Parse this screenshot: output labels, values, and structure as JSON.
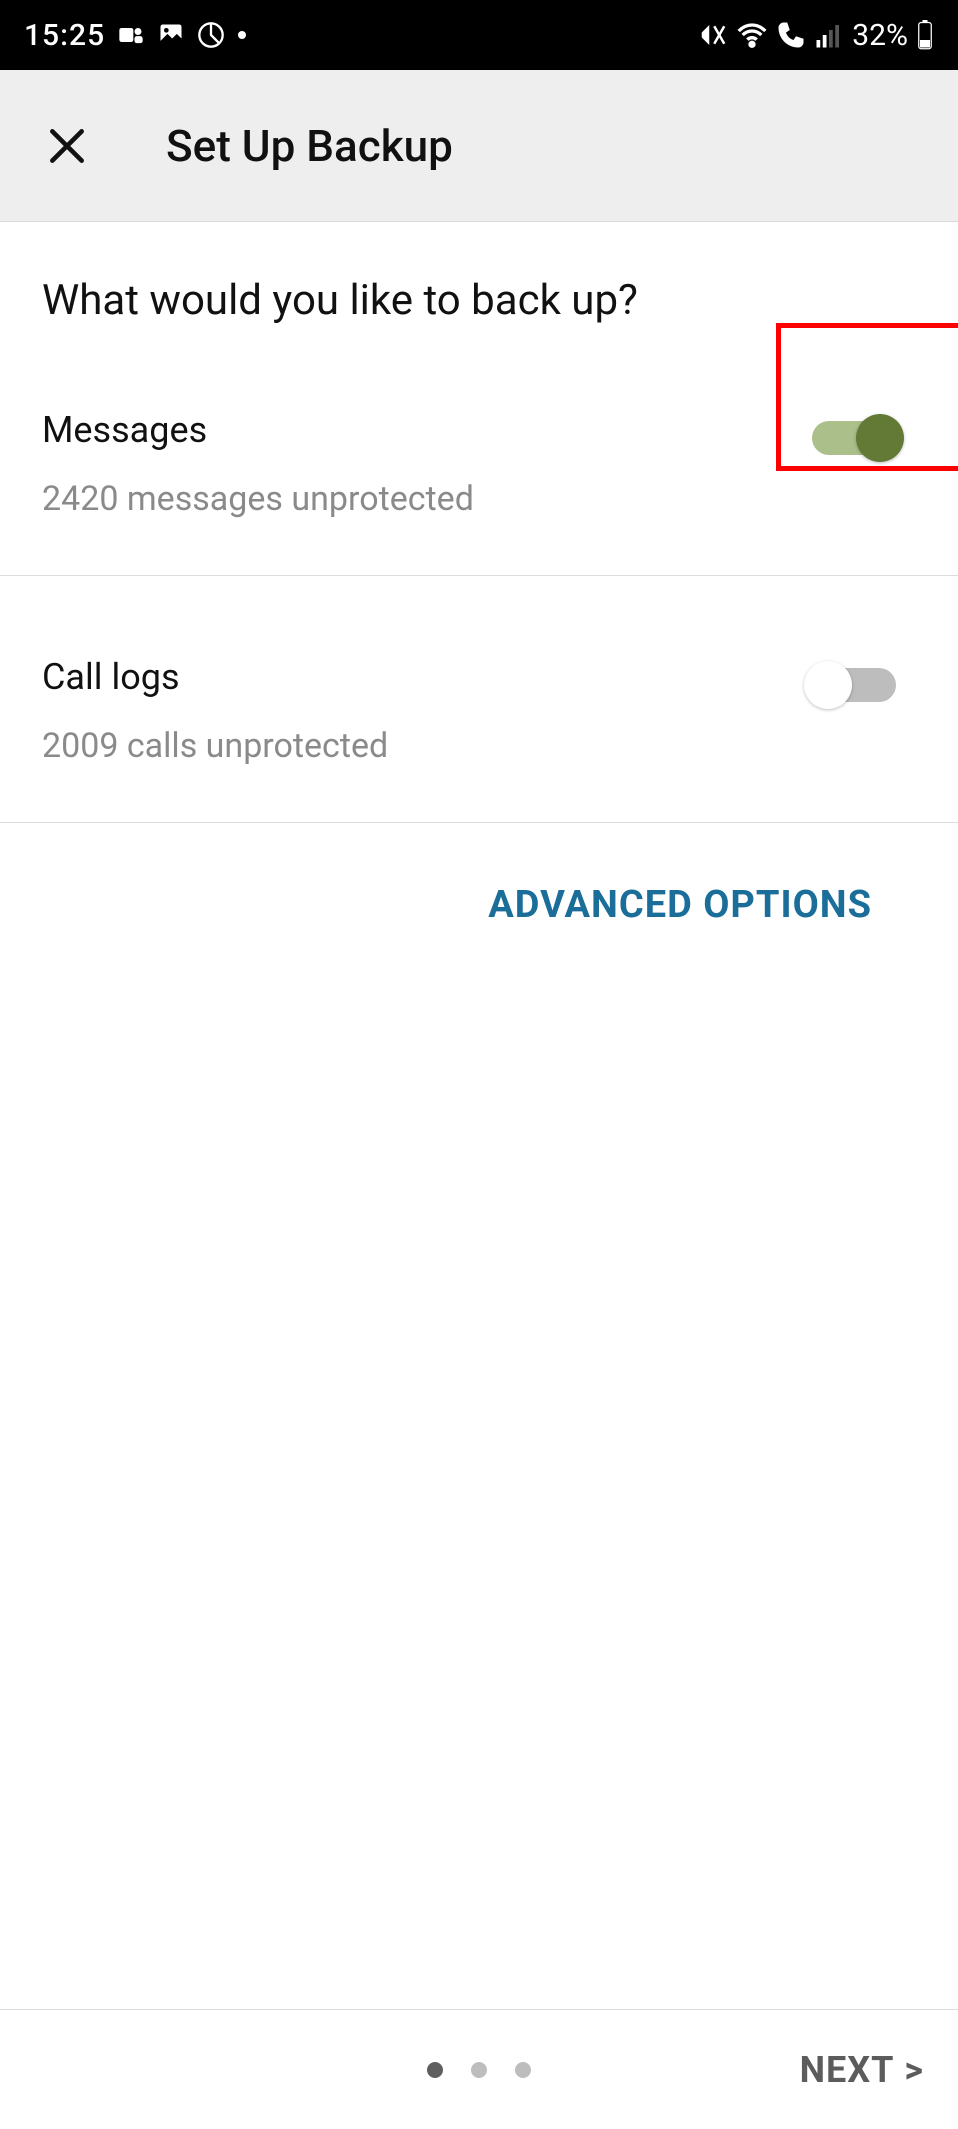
{
  "status": {
    "time": "15:25",
    "battery_text": "32%"
  },
  "header": {
    "title": "Set Up Backup"
  },
  "main": {
    "heading": "What would you like to back up?",
    "items": [
      {
        "label": "Messages",
        "sub": "2420 messages unprotected",
        "enabled": true
      },
      {
        "label": "Call logs",
        "sub": "2009 calls unprotected",
        "enabled": false
      }
    ],
    "advanced_label": "ADVANCED OPTIONS"
  },
  "footer": {
    "next_label": "NEXT",
    "pages_total": 3,
    "page_current": 1
  },
  "highlight": {
    "target": "messages-toggle"
  }
}
